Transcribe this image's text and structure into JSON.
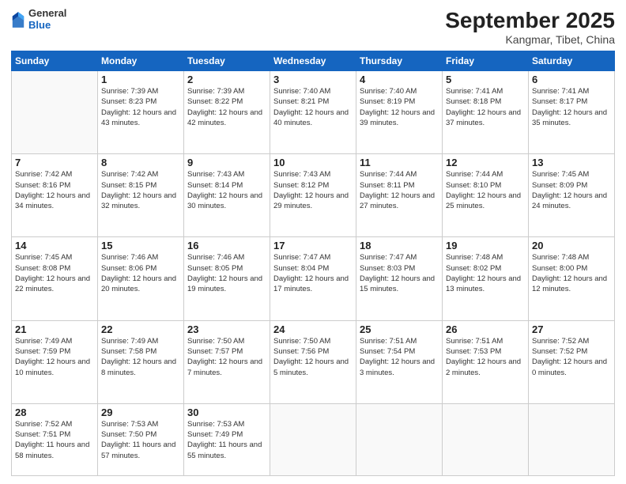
{
  "header": {
    "logo": {
      "general": "General",
      "blue": "Blue"
    },
    "title": "September 2025",
    "subtitle": "Kangmar, Tibet, China"
  },
  "weekdays": [
    "Sunday",
    "Monday",
    "Tuesday",
    "Wednesday",
    "Thursday",
    "Friday",
    "Saturday"
  ],
  "weeks": [
    [
      {
        "day": null,
        "info": null
      },
      {
        "day": "1",
        "info": "Sunrise: 7:39 AM\nSunset: 8:23 PM\nDaylight: 12 hours\nand 43 minutes."
      },
      {
        "day": "2",
        "info": "Sunrise: 7:39 AM\nSunset: 8:22 PM\nDaylight: 12 hours\nand 42 minutes."
      },
      {
        "day": "3",
        "info": "Sunrise: 7:40 AM\nSunset: 8:21 PM\nDaylight: 12 hours\nand 40 minutes."
      },
      {
        "day": "4",
        "info": "Sunrise: 7:40 AM\nSunset: 8:19 PM\nDaylight: 12 hours\nand 39 minutes."
      },
      {
        "day": "5",
        "info": "Sunrise: 7:41 AM\nSunset: 8:18 PM\nDaylight: 12 hours\nand 37 minutes."
      },
      {
        "day": "6",
        "info": "Sunrise: 7:41 AM\nSunset: 8:17 PM\nDaylight: 12 hours\nand 35 minutes."
      }
    ],
    [
      {
        "day": "7",
        "info": "Sunrise: 7:42 AM\nSunset: 8:16 PM\nDaylight: 12 hours\nand 34 minutes."
      },
      {
        "day": "8",
        "info": "Sunrise: 7:42 AM\nSunset: 8:15 PM\nDaylight: 12 hours\nand 32 minutes."
      },
      {
        "day": "9",
        "info": "Sunrise: 7:43 AM\nSunset: 8:14 PM\nDaylight: 12 hours\nand 30 minutes."
      },
      {
        "day": "10",
        "info": "Sunrise: 7:43 AM\nSunset: 8:12 PM\nDaylight: 12 hours\nand 29 minutes."
      },
      {
        "day": "11",
        "info": "Sunrise: 7:44 AM\nSunset: 8:11 PM\nDaylight: 12 hours\nand 27 minutes."
      },
      {
        "day": "12",
        "info": "Sunrise: 7:44 AM\nSunset: 8:10 PM\nDaylight: 12 hours\nand 25 minutes."
      },
      {
        "day": "13",
        "info": "Sunrise: 7:45 AM\nSunset: 8:09 PM\nDaylight: 12 hours\nand 24 minutes."
      }
    ],
    [
      {
        "day": "14",
        "info": "Sunrise: 7:45 AM\nSunset: 8:08 PM\nDaylight: 12 hours\nand 22 minutes."
      },
      {
        "day": "15",
        "info": "Sunrise: 7:46 AM\nSunset: 8:06 PM\nDaylight: 12 hours\nand 20 minutes."
      },
      {
        "day": "16",
        "info": "Sunrise: 7:46 AM\nSunset: 8:05 PM\nDaylight: 12 hours\nand 19 minutes."
      },
      {
        "day": "17",
        "info": "Sunrise: 7:47 AM\nSunset: 8:04 PM\nDaylight: 12 hours\nand 17 minutes."
      },
      {
        "day": "18",
        "info": "Sunrise: 7:47 AM\nSunset: 8:03 PM\nDaylight: 12 hours\nand 15 minutes."
      },
      {
        "day": "19",
        "info": "Sunrise: 7:48 AM\nSunset: 8:02 PM\nDaylight: 12 hours\nand 13 minutes."
      },
      {
        "day": "20",
        "info": "Sunrise: 7:48 AM\nSunset: 8:00 PM\nDaylight: 12 hours\nand 12 minutes."
      }
    ],
    [
      {
        "day": "21",
        "info": "Sunrise: 7:49 AM\nSunset: 7:59 PM\nDaylight: 12 hours\nand 10 minutes."
      },
      {
        "day": "22",
        "info": "Sunrise: 7:49 AM\nSunset: 7:58 PM\nDaylight: 12 hours\nand 8 minutes."
      },
      {
        "day": "23",
        "info": "Sunrise: 7:50 AM\nSunset: 7:57 PM\nDaylight: 12 hours\nand 7 minutes."
      },
      {
        "day": "24",
        "info": "Sunrise: 7:50 AM\nSunset: 7:56 PM\nDaylight: 12 hours\nand 5 minutes."
      },
      {
        "day": "25",
        "info": "Sunrise: 7:51 AM\nSunset: 7:54 PM\nDaylight: 12 hours\nand 3 minutes."
      },
      {
        "day": "26",
        "info": "Sunrise: 7:51 AM\nSunset: 7:53 PM\nDaylight: 12 hours\nand 2 minutes."
      },
      {
        "day": "27",
        "info": "Sunrise: 7:52 AM\nSunset: 7:52 PM\nDaylight: 12 hours\nand 0 minutes."
      }
    ],
    [
      {
        "day": "28",
        "info": "Sunrise: 7:52 AM\nSunset: 7:51 PM\nDaylight: 11 hours\nand 58 minutes."
      },
      {
        "day": "29",
        "info": "Sunrise: 7:53 AM\nSunset: 7:50 PM\nDaylight: 11 hours\nand 57 minutes."
      },
      {
        "day": "30",
        "info": "Sunrise: 7:53 AM\nSunset: 7:49 PM\nDaylight: 11 hours\nand 55 minutes."
      },
      {
        "day": null,
        "info": null
      },
      {
        "day": null,
        "info": null
      },
      {
        "day": null,
        "info": null
      },
      {
        "day": null,
        "info": null
      }
    ]
  ]
}
